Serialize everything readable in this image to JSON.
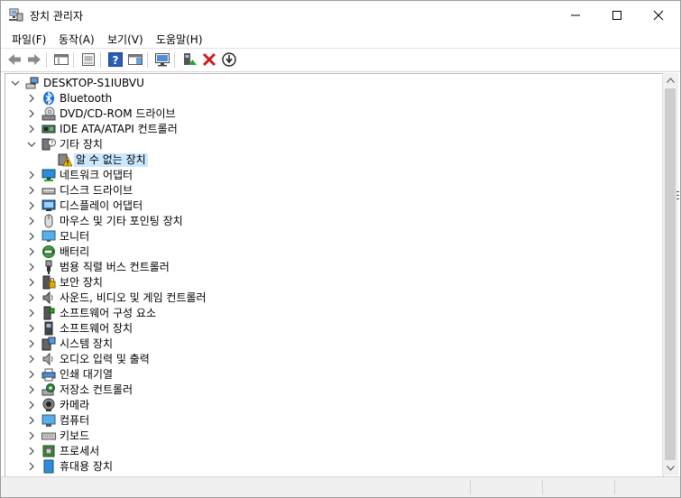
{
  "window": {
    "title": "장치 관리자"
  },
  "menu": [
    "파일(F)",
    "동작(A)",
    "보기(V)",
    "도움말(H)"
  ],
  "tree": {
    "root": "DESKTOP-S1IUBVU",
    "nodes": [
      {
        "label": "Bluetooth",
        "icon": "bluetooth-icon",
        "state": "collapsed"
      },
      {
        "label": "DVD/CD-ROM 드라이브",
        "icon": "optical-drive-icon",
        "state": "collapsed"
      },
      {
        "label": "IDE ATA/ATAPI 컨트롤러",
        "icon": "ide-controller-icon",
        "state": "collapsed"
      },
      {
        "label": "기타 장치",
        "icon": "other-devices-icon",
        "state": "expanded"
      },
      {
        "label": "알 수 없는 장치",
        "icon": "unknown-device-warning-icon",
        "state": "child-selected"
      },
      {
        "label": "네트워크 어댑터",
        "icon": "network-adapter-icon",
        "state": "collapsed"
      },
      {
        "label": "디스크 드라이브",
        "icon": "disk-drive-icon",
        "state": "collapsed"
      },
      {
        "label": "디스플레이 어댑터",
        "icon": "display-adapter-icon",
        "state": "collapsed"
      },
      {
        "label": "마우스 및 기타 포인팅 장치",
        "icon": "mouse-icon",
        "state": "collapsed"
      },
      {
        "label": "모니터",
        "icon": "monitor-icon",
        "state": "collapsed"
      },
      {
        "label": "배터리",
        "icon": "battery-icon",
        "state": "collapsed"
      },
      {
        "label": "범용 직렬 버스 컨트롤러",
        "icon": "usb-icon",
        "state": "collapsed"
      },
      {
        "label": "보안 장치",
        "icon": "security-device-icon",
        "state": "collapsed"
      },
      {
        "label": "사운드, 비디오 및 게임 컨트롤러",
        "icon": "sound-icon",
        "state": "collapsed"
      },
      {
        "label": "소프트웨어 구성 요소",
        "icon": "software-component-icon",
        "state": "collapsed"
      },
      {
        "label": "소프트웨어 장치",
        "icon": "software-device-icon",
        "state": "collapsed"
      },
      {
        "label": "시스템 장치",
        "icon": "system-device-icon",
        "state": "collapsed"
      },
      {
        "label": "오디오 입력 및 출력",
        "icon": "audio-io-icon",
        "state": "collapsed"
      },
      {
        "label": "인쇄 대기열",
        "icon": "print-queue-icon",
        "state": "collapsed"
      },
      {
        "label": "저장소 컨트롤러",
        "icon": "storage-controller-icon",
        "state": "collapsed"
      },
      {
        "label": "카메라",
        "icon": "camera-icon",
        "state": "collapsed"
      },
      {
        "label": "컴퓨터",
        "icon": "computer-icon",
        "state": "collapsed"
      },
      {
        "label": "키보드",
        "icon": "keyboard-icon",
        "state": "collapsed"
      },
      {
        "label": "프로세서",
        "icon": "processor-icon",
        "state": "collapsed"
      },
      {
        "label": "휴대용 장치",
        "icon": "portable-device-icon",
        "state": "collapsed"
      }
    ]
  },
  "colors": {
    "selection": "#cce8ff",
    "accent": "#1e73c8",
    "warning": "#f2c300",
    "delete": "#d01b1b"
  }
}
